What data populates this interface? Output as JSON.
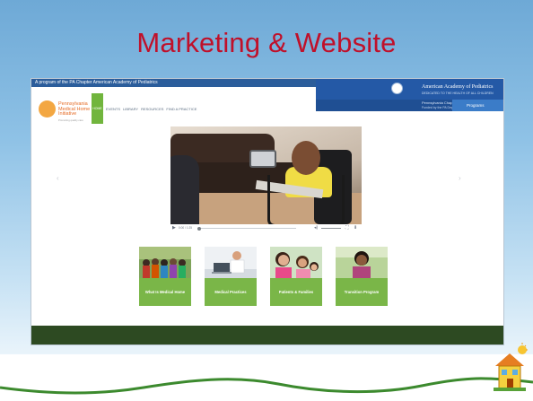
{
  "slide": {
    "title": "Marketing & Website",
    "colors": {
      "title": "#c0102a",
      "sky": "#8fc2e6",
      "accent_green": "#7ab648"
    }
  },
  "website": {
    "top_banner": "A program of the PA Chapter American Academy of Pediatrics",
    "aap": {
      "name": "American Academy of Pediatrics",
      "tagline": "DEDICATED TO THE HEALTH OF ALL CHILDREN",
      "chapter": "Pennsylvania Chapter",
      "funding": "Funded by the PA Department of Health",
      "programs_button": "Programs"
    },
    "logo": {
      "name": "Pennsylvania Medical Home Initiative",
      "tagline": "Promoting quality care"
    },
    "nav": {
      "home": "HOME",
      "items": [
        "EVENTS",
        "LIBRARY",
        "RESOURCES",
        "FIND A PRACTICE"
      ]
    },
    "carousel": {
      "prev_icon": "chevron-left-icon",
      "next_icon": "chevron-right-icon"
    },
    "video": {
      "time": "0:00 / 1:25",
      "progress": 0.0,
      "volume": 1.0,
      "icons": [
        "play-icon",
        "volume-icon",
        "fullscreen-icon",
        "download-icon"
      ]
    },
    "cards": [
      {
        "label": "What Is Medical Home"
      },
      {
        "label": "Medical Practices"
      },
      {
        "label": "Patients & Families"
      },
      {
        "label": "Transition Program"
      }
    ]
  }
}
